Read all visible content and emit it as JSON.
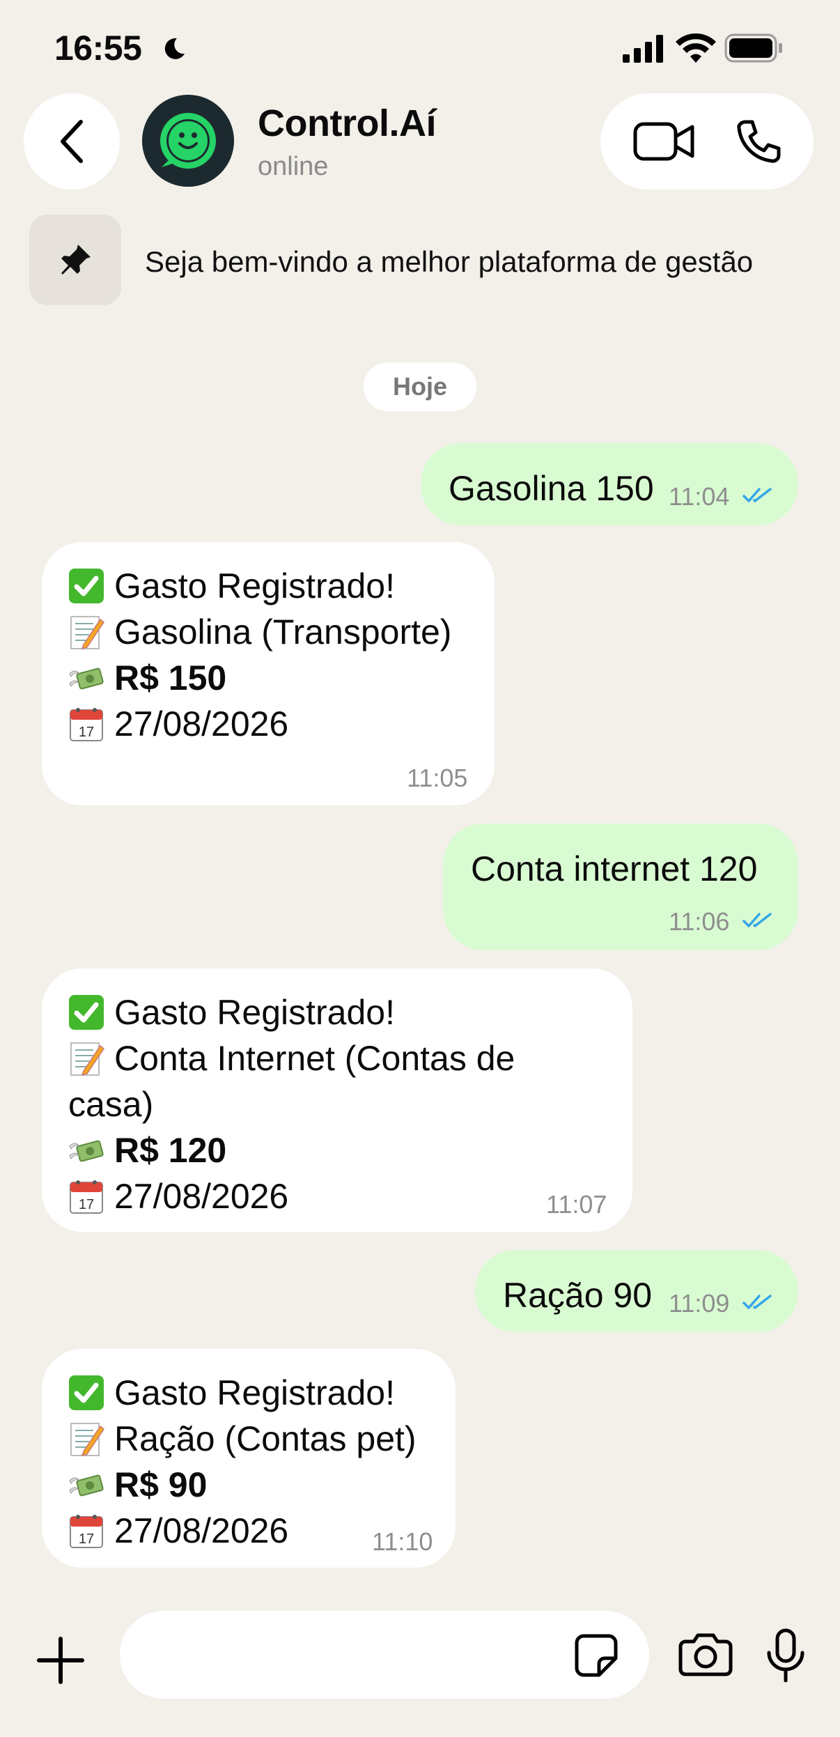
{
  "status_bar": {
    "time": "16:55"
  },
  "header": {
    "contact_name": "Control.Aí",
    "contact_status": "online"
  },
  "pinned": {
    "text": "Seja bem-vindo a melhor plataforma de gestão"
  },
  "date_chip": "Hoje",
  "messages": [
    {
      "text": "Gasolina 150",
      "time": "11:04"
    },
    {
      "title": "Gasto Registrado!",
      "desc": "Gasolina (Transporte)",
      "amount": "R$ 150",
      "date": "27/08/2026",
      "time": "11:05"
    },
    {
      "text": "Conta internet 120",
      "time": "11:06"
    },
    {
      "title": "Gasto Registrado!",
      "desc1": "Conta Internet (Contas de",
      "desc2": "casa)",
      "amount": "R$ 120",
      "date": "27/08/2026",
      "time": "11:07"
    },
    {
      "text": "Ração 90",
      "time": "11:09"
    },
    {
      "title": "Gasto Registrado!",
      "desc": "Ração (Contas pet)",
      "amount": "R$ 90",
      "date": "27/08/2026",
      "time": "11:10"
    }
  ],
  "icons": {
    "check": "check-mark-button-emoji",
    "memo": "memo-emoji",
    "money": "money-with-wings-emoji",
    "calendar": "calendar-emoji",
    "read_ticks": "double-check-icon"
  },
  "colors": {
    "outgoing_bubble": "#d9fbd2",
    "incoming_bubble": "#ffffff",
    "background": "#f3f0ea",
    "read_ticks": "#35a7e8",
    "brand_green": "#25d366"
  }
}
